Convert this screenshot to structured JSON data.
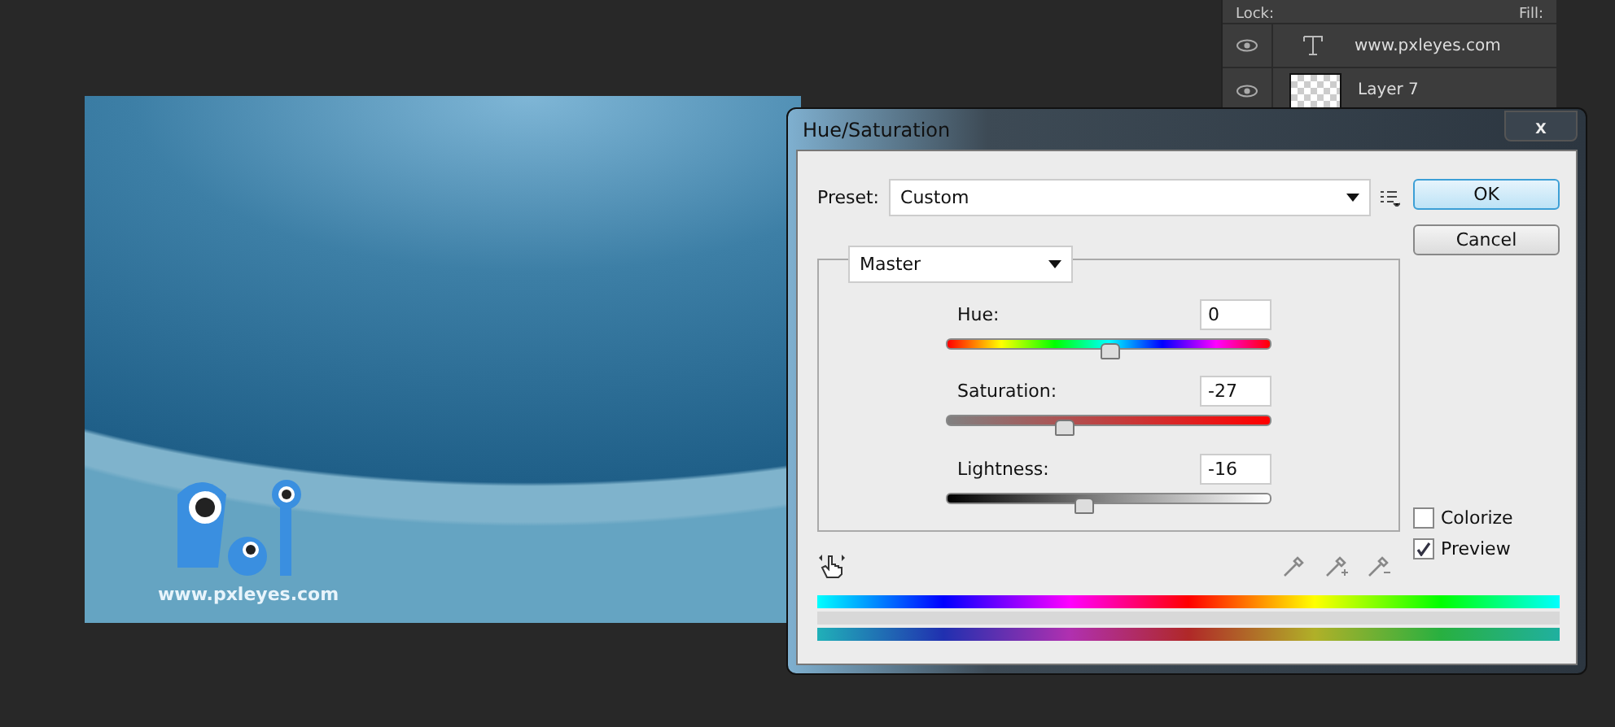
{
  "document": {
    "logo_text": "www.pxleyes.com"
  },
  "layers_panel": {
    "lock_label": "Lock:",
    "fill_label": "Fill:",
    "layers": [
      {
        "kind": "text",
        "name": "www.pxleyes.com"
      },
      {
        "kind": "pixel",
        "name": "Layer 7"
      }
    ]
  },
  "dialog": {
    "title": "Hue/Saturation",
    "close": "x",
    "preset_label": "Preset:",
    "preset_value": "Custom",
    "channel": "Master",
    "sliders": [
      {
        "kind": "hue",
        "label": "Hue:",
        "value": "0",
        "level": 0.5
      },
      {
        "kind": "saturation",
        "label": "Saturation:",
        "value": "-27",
        "level": 0.36
      },
      {
        "kind": "lightness",
        "label": "Lightness:",
        "value": "-16",
        "level": 0.42
      }
    ],
    "buttons": [
      {
        "label": "OK",
        "default": true
      },
      {
        "label": "Cancel",
        "default": false
      }
    ],
    "options": [
      {
        "label": "Colorize",
        "checked": false
      },
      {
        "label": "Preview",
        "checked": true
      }
    ]
  }
}
